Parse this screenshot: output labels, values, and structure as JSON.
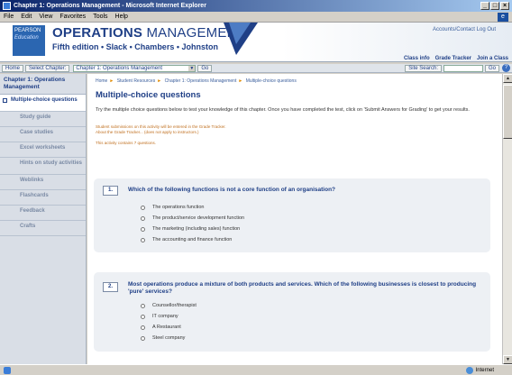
{
  "window": {
    "title": "Chapter 1: Operations Management - Microsoft Internet Explorer",
    "buttons": [
      "_",
      "□",
      "×"
    ]
  },
  "menu": [
    "File",
    "Edit",
    "View",
    "Favorites",
    "Tools",
    "Help"
  ],
  "header": {
    "publisher_line1": "PEARSON",
    "publisher_line2": "Education",
    "title_bold": "OPERATIONS",
    "title_light": "MANAGEMENT",
    "subtitle": "Fifth edition • Slack • Chambers • Johnston",
    "account_link": "Accounts/Contact Log Out",
    "tabs": [
      "Class info",
      "Grade Tracker",
      "Join a Class"
    ]
  },
  "navbar": {
    "home": "Home",
    "select_chapter": "Select Chapter:",
    "chapter_value": "Chapter 1: Operations Management",
    "go": "Go",
    "site_search": "Site Search:",
    "go2": "Go",
    "help": "?"
  },
  "sidebar": {
    "chapter_heading": "Chapter 1: Operations Management",
    "items": [
      {
        "label": "Multiple-choice questions",
        "active": true
      },
      {
        "label": "Study guide"
      },
      {
        "label": "Case studies"
      },
      {
        "label": "Excel worksheets"
      },
      {
        "label": "Hints on study activities"
      },
      {
        "label": "Weblinks"
      },
      {
        "label": "Flashcards"
      },
      {
        "label": "Feedback"
      },
      {
        "label": "Crafts"
      }
    ]
  },
  "content": {
    "breadcrumb": [
      "Home",
      "Student Resources",
      "Chapter 1: Operations Management",
      "Multiple-choice questions"
    ],
    "title": "Multiple-choice questions",
    "intro": "Try the multiple choice questions below to test your knowledge of this chapter. Once you have completed the test, click on 'Submit Answers for Grading' to get your results.",
    "note_line1": "Student submissions on this activity will be entered in the Grade Tracker.",
    "note_line2": "About the Grade Tracker... (does not apply to instructors.)",
    "activity_count": "This activity contains 7 questions.",
    "questions": [
      {
        "number": "1.",
        "text": "Which of the following functions is not a core function of an organisation?",
        "options": [
          "The operations function",
          "The product/service development function",
          "The marketing (including sales) function",
          "The accounting and finance function"
        ]
      },
      {
        "number": "2.",
        "text": "Most operations produce a mixture of both products and services. Which of the following businesses is closest to producing 'pure' services?",
        "options": [
          "Counsellor/therapist",
          "IT company",
          "A Restaurant",
          "Steel company"
        ]
      }
    ]
  },
  "status": {
    "left": "",
    "zone": "Internet"
  },
  "colors": {
    "brand_blue": "#1f3f86",
    "panel": "#edf0f4",
    "note_orange": "#c07020"
  }
}
